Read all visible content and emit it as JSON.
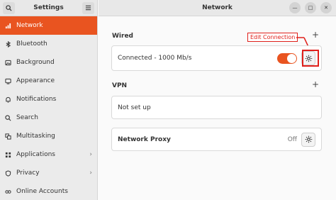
{
  "sidebar": {
    "title": "Settings",
    "items": [
      {
        "label": "Network",
        "icon": "network-icon",
        "active": true
      },
      {
        "label": "Bluetooth",
        "icon": "bluetooth-icon"
      },
      {
        "label": "Background",
        "icon": "background-icon"
      },
      {
        "label": "Appearance",
        "icon": "appearance-icon"
      },
      {
        "label": "Notifications",
        "icon": "bell-icon"
      },
      {
        "label": "Search",
        "icon": "search-icon"
      },
      {
        "label": "Multitasking",
        "icon": "multitasking-icon"
      },
      {
        "label": "Applications",
        "icon": "applications-icon",
        "chevron": "›"
      },
      {
        "label": "Privacy",
        "icon": "privacy-icon",
        "chevron": "›"
      },
      {
        "label": "Online Accounts",
        "icon": "online-accounts-icon"
      }
    ]
  },
  "header": {
    "title": "Network"
  },
  "wired": {
    "title": "Wired",
    "connection": "Connected - 1000 Mb/s",
    "toggle_on": true
  },
  "vpn": {
    "title": "VPN",
    "status": "Not set up"
  },
  "proxy": {
    "title": "Network Proxy",
    "status": "Off"
  },
  "annotation": {
    "label": "Edit Connection",
    "color": "#e0201b"
  },
  "colors": {
    "accent": "#e95420"
  }
}
